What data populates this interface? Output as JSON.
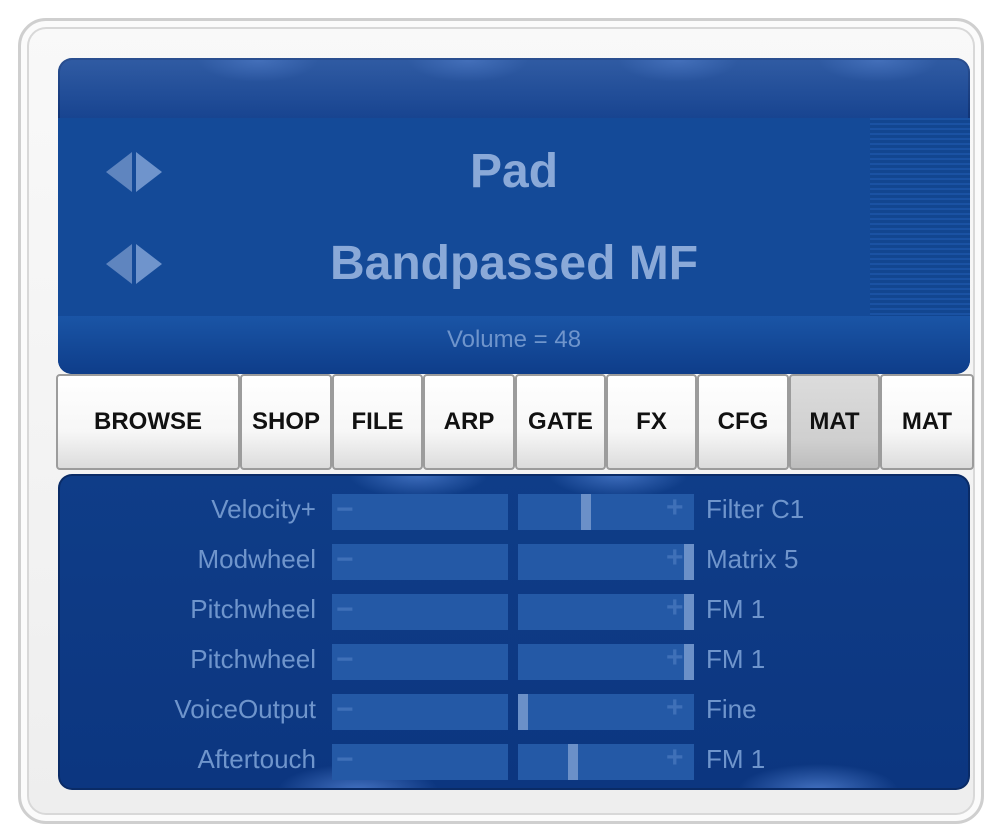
{
  "display": {
    "category": "Pad",
    "patch_name": "Bandpassed MF",
    "volume_text": "Volume = 48"
  },
  "tabs": [
    {
      "label": "BROWSE",
      "active": false
    },
    {
      "label": "SHOP",
      "active": false
    },
    {
      "label": "FILE",
      "active": false
    },
    {
      "label": "ARP",
      "active": false
    },
    {
      "label": "GATE",
      "active": false
    },
    {
      "label": "FX",
      "active": false
    },
    {
      "label": "CFG",
      "active": false
    },
    {
      "label": "MAT",
      "active": true
    },
    {
      "label": "MAT",
      "active": false
    }
  ],
  "matrix": {
    "minus_symbol": "−",
    "plus_symbol": "+",
    "rows": [
      {
        "source": "Velocity+",
        "destination": "Filter C1",
        "amount": 0.38
      },
      {
        "source": "Modwheel",
        "destination": "Matrix 5",
        "amount": 1.0
      },
      {
        "source": "Pitchwheel",
        "destination": "FM 1",
        "amount": 1.0
      },
      {
        "source": "Pitchwheel",
        "destination": "FM 1",
        "amount": 1.0
      },
      {
        "source": "VoiceOutput",
        "destination": "Fine",
        "amount": 0.0
      },
      {
        "source": "Aftertouch",
        "destination": "FM 1",
        "amount": 0.3
      }
    ]
  },
  "colors": {
    "panel_blue": "#0f3f8c",
    "text_blue": "#8aa9d8",
    "active_tab": "#cfcfcf"
  }
}
